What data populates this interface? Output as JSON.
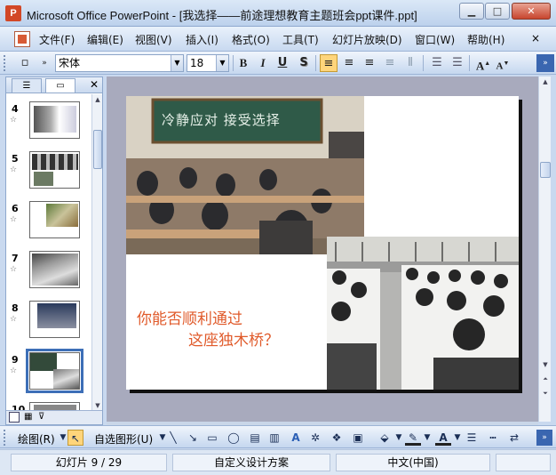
{
  "window": {
    "title": "Microsoft Office PowerPoint - [我选择——前途理想教育主题班会ppt课件.ppt]",
    "app_icon_letter": "P",
    "controls": {
      "minimize": "▁",
      "maximize": "□",
      "close": "✕"
    }
  },
  "menu": {
    "items": [
      "文件(F)",
      "编辑(E)",
      "视图(V)",
      "插入(I)",
      "格式(O)",
      "工具(T)",
      "幻灯片放映(D)",
      "窗口(W)",
      "帮助(H)"
    ],
    "close_doc": "×"
  },
  "toolbar": {
    "font_name": "宋体",
    "font_size": "18",
    "bold": "B",
    "italic": "I",
    "underline": "U",
    "shadow": "S",
    "align_left": "≡",
    "align_center": "≡",
    "align_right": "≡",
    "grow_font": "A",
    "shrink_font": "A"
  },
  "slides_panel": {
    "tab_outline": "☰",
    "tab_slides": "▭",
    "close": "✕",
    "slides": [
      {
        "number": "4"
      },
      {
        "number": "5"
      },
      {
        "number": "6"
      },
      {
        "number": "7"
      },
      {
        "number": "8"
      },
      {
        "number": "9"
      },
      {
        "number": "10"
      }
    ],
    "selected_number": "9"
  },
  "slide": {
    "chalkboard_text": "冷静应对  接受选择",
    "line1": "你能否顺利通过",
    "line2": "这座独木桥？"
  },
  "drawing_toolbar": {
    "draw_label": "绘图(R)",
    "autoshapes_label": "自选图形(U)"
  },
  "status": {
    "slide_pos": "幻灯片 9 / 29",
    "design": "自定义设计方案",
    "language": "中文(中国)"
  }
}
